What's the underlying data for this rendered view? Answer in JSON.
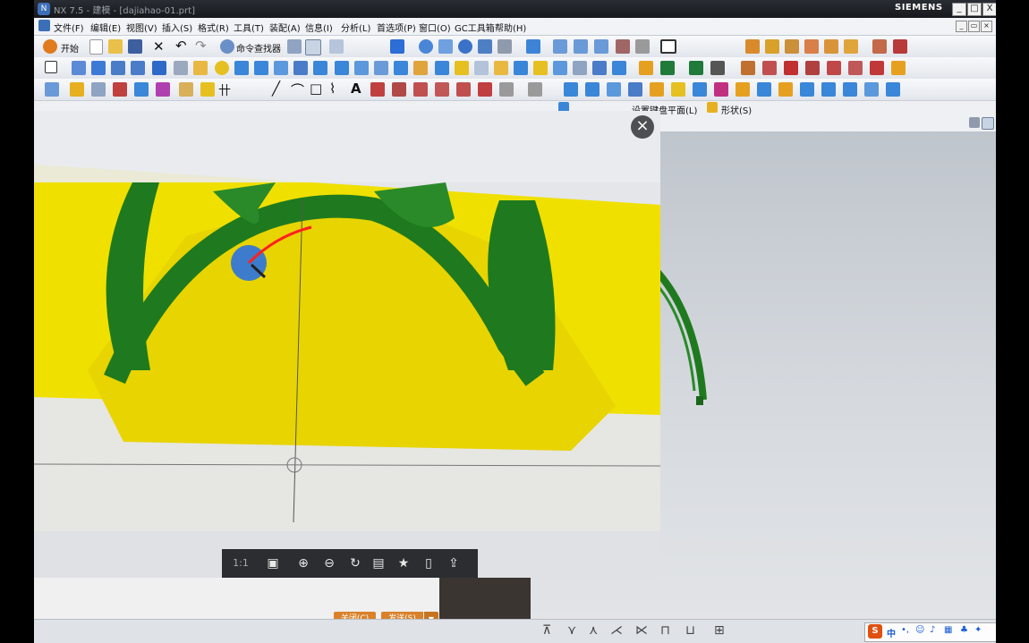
{
  "window": {
    "title": "NX 7.5 - 建模 - [dajiahao-01.prt]",
    "brand": "SIEMENS",
    "controls": [
      "_",
      "□",
      "X"
    ]
  },
  "menu": {
    "items": [
      "文件(F)",
      "编辑(E)",
      "视图(V)",
      "插入(S)",
      "格式(R)",
      "工具(T)",
      "装配(A)",
      "信息(I)",
      "分析(L)",
      "首选项(P)",
      "窗口(O)",
      "GC工具箱",
      "帮助(H)"
    ]
  },
  "toolbar": {
    "start_label": "开始",
    "command_finder_label": "命令查找器"
  },
  "selection_bar": {
    "set_plane_label": "设置键盘平面(L)",
    "shape_label": "形状(S)"
  },
  "photo_viewer": {
    "ratio_label": "1:1",
    "close_symbol": "×"
  },
  "dialog": {
    "close_label": "关闭(C)",
    "send_label": "发送(S)"
  },
  "ime": {
    "logo": "S",
    "mode": "中"
  },
  "colors": {
    "model_green": "#1f7a1f",
    "surface_yellow": "#f0e000",
    "button_orange": "#d9822b",
    "titlebar_dark": "#1c1e22"
  }
}
